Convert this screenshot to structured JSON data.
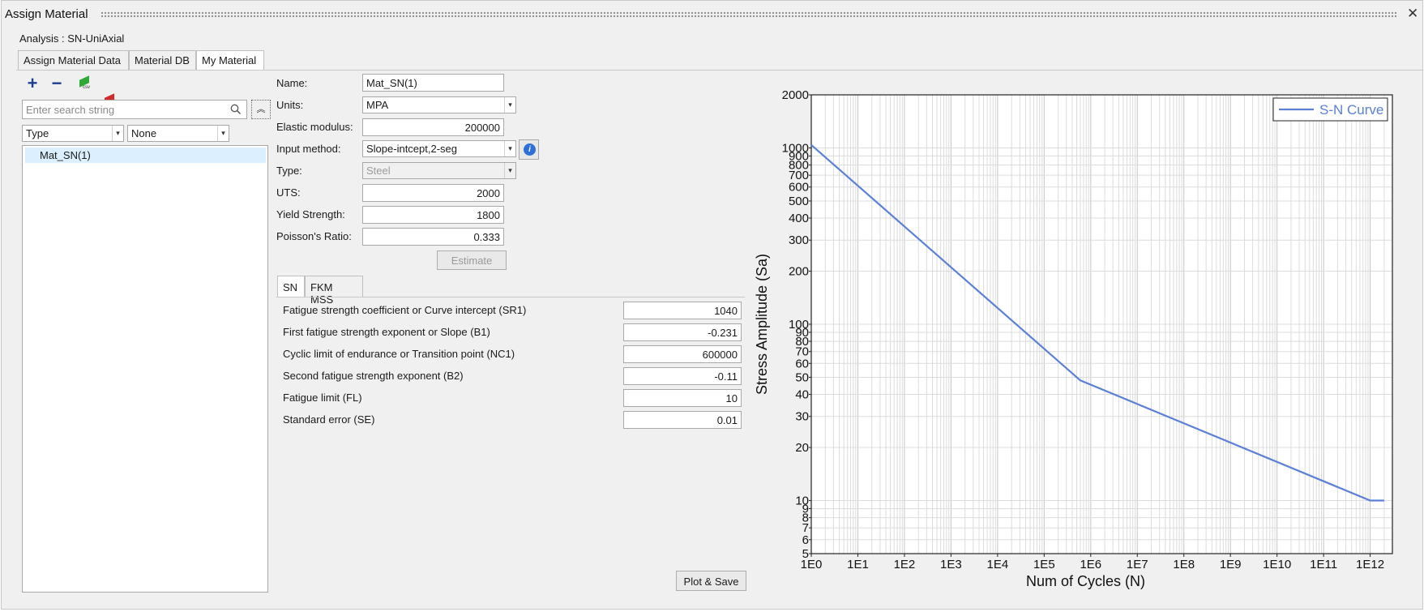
{
  "window": {
    "title": "Assign Material",
    "close_glyph": "✕"
  },
  "analysis_label": "Analysis : SN-UniAxial",
  "tabs": [
    {
      "label": "Assign Material Data",
      "active": false
    },
    {
      "label": "Material DB",
      "active": false
    },
    {
      "label": "My Material",
      "active": true
    }
  ],
  "toolbar": {
    "add_glyph": "+",
    "remove_glyph": "−",
    "import_csv_label": "csv",
    "export_csv_label": "csv",
    "colors": {
      "import": "#2fa836",
      "export": "#d42a2a"
    }
  },
  "search": {
    "placeholder": "Enter search string",
    "collapse_glyph": "︽"
  },
  "filters": {
    "type_value": "Type",
    "value_value": "None"
  },
  "material_list": [
    "Mat_SN(1)"
  ],
  "form": {
    "name_label": "Name:",
    "name_value": "Mat_SN(1)",
    "units_label": "Units:",
    "units_value": "MPA",
    "elastic_label": "Elastic modulus:",
    "elastic_value": "200000",
    "input_method_label": "Input method:",
    "input_method_value": "Slope-intcept,2-seg",
    "info_glyph": "i",
    "type_label": "Type:",
    "type_value": "Steel",
    "uts_label": "UTS:",
    "uts_value": "2000",
    "yield_label": "Yield Strength:",
    "yield_value": "1800",
    "poisson_label": "Poisson's Ratio:",
    "poisson_value": "0.333",
    "estimate_label": "Estimate"
  },
  "subtabs": [
    {
      "label": "SN",
      "active": true
    },
    {
      "label": "FKM MSS",
      "active": false
    }
  ],
  "sn_params": [
    {
      "label": "Fatigue strength coefficient or Curve intercept (SR1)",
      "value": "1040"
    },
    {
      "label": "First fatigue strength exponent or Slope (B1)",
      "value": "-0.231"
    },
    {
      "label": "Cyclic limit of endurance or Transition point (NC1)",
      "value": "600000"
    },
    {
      "label": "Second fatigue strength exponent (B2)",
      "value": "-0.11"
    },
    {
      "label": "Fatigue limit (FL)",
      "value": "10"
    },
    {
      "label": "Standard error (SE)",
      "value": "0.01"
    }
  ],
  "plot_save_label": "Plot & Save",
  "chart_data": {
    "type": "line",
    "title": "",
    "xlabel": "Num of Cycles (N)",
    "ylabel": "Stress Amplitude (Sa)",
    "xscale": "log",
    "yscale": "log",
    "xlim": [
      1,
      3000000000000.0
    ],
    "ylim": [
      5,
      2000
    ],
    "grid": true,
    "legend_position": "top-right",
    "x_tick_labels": [
      "1E0",
      "1E1",
      "1E2",
      "1E3",
      "1E4",
      "1E5",
      "1E6",
      "1E7",
      "1E8",
      "1E9",
      "1E10",
      "1E11",
      "1E12"
    ],
    "y_tick_labels": [
      "5",
      "6",
      "7",
      "8",
      "9",
      "10",
      "20",
      "30",
      "40",
      "50",
      "60",
      "70",
      "80",
      "90",
      "100",
      "200",
      "300",
      "400",
      "500",
      "600",
      "700",
      "800",
      "900",
      "1000",
      "2000"
    ],
    "series": [
      {
        "name": "S-N Curve",
        "color": "#5b80d6",
        "x": [
          1,
          600000,
          1000000000000,
          2000000000000
        ],
        "y": [
          1040,
          48,
          10,
          10
        ]
      }
    ]
  }
}
